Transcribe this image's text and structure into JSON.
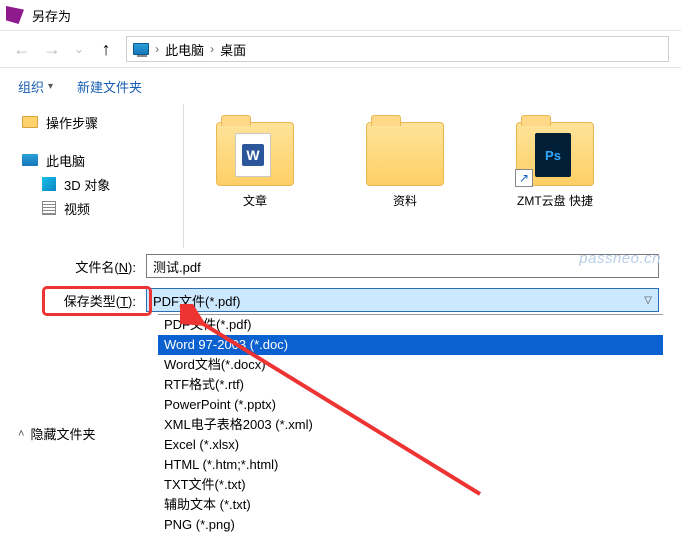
{
  "title": "另存为",
  "breadcrumb": {
    "pc": "此电脑",
    "desktop": "桌面"
  },
  "toolbar": {
    "organize": "组织",
    "newfolder": "新建文件夹"
  },
  "tree": {
    "steps": "操作步骤",
    "pc": "此电脑",
    "obj3d": "3D 对象",
    "video": "视频"
  },
  "files": {
    "f1": "文章",
    "f2": "资料",
    "f3": "ZMT云盘  快捷"
  },
  "labels": {
    "filename": "文件名(",
    "filename_key": "N",
    "filename_suffix": "):",
    "savetype": "保存类型(",
    "savetype_key": "T",
    "savetype_suffix": "):",
    "hidden": "隐藏文件夹"
  },
  "filename_value": "测试.pdf",
  "current_filter": "PDF文件(*.pdf)",
  "options": [
    "PDF文件(*.pdf)",
    "Word 97-2003 (*.doc)",
    "Word文档(*.docx)",
    "RTF格式(*.rtf)",
    "PowerPoint (*.pptx)",
    "XML电子表格2003 (*.xml)",
    "Excel (*.xlsx)",
    "HTML (*.htm;*.html)",
    "TXT文件(*.txt)",
    "辅助文本 (*.txt)",
    "PNG (*.png)"
  ],
  "selected_option_index": 1,
  "watermark": "passneo.cn"
}
